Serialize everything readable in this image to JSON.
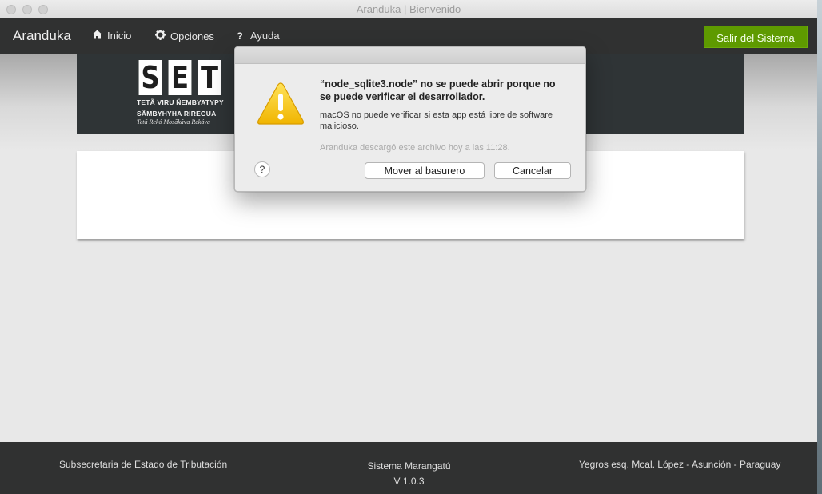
{
  "window": {
    "title": "Aranduka | Bienvenido"
  },
  "navbar": {
    "brand": "Aranduka",
    "items": [
      {
        "label": "Inicio",
        "icon": "home-icon"
      },
      {
        "label": "Opciones",
        "icon": "gear-icon"
      },
      {
        "label": "Ayuda",
        "icon": "question-icon"
      }
    ],
    "logout_label": "Salir del Sistema"
  },
  "banner": {
    "logo_letters": [
      "S",
      "E",
      "T"
    ],
    "logo_line1": "TETÃ VIRU ÑEMBYATYPY",
    "logo_line2": "SÃMBYHYHA RIREGUA",
    "logo_signature": "Tetã Rekó Mosãkãva Rekáva"
  },
  "dialog": {
    "title": "“node_sqlite3.node” no se puede abrir porque no se puede verificar el desarrollador.",
    "message": "macOS no puede verificar si esta app está libre de software malicioso.",
    "note": "Aranduka descargó este archivo hoy a las 11:28.",
    "help_label": "?",
    "trash_button": "Mover al basurero",
    "cancel_button": "Cancelar",
    "icon": "warning-icon"
  },
  "footer": {
    "left": "Subsecretaria de Estado de Tributación",
    "center_name": "Sistema Marangatú",
    "center_version": "V 1.0.3",
    "right": "Yegros esq. Mcal. López - Asunción - Paraguay"
  },
  "colors": {
    "navbar": "#303131",
    "logout_button": "#5e9a00",
    "banner": "#2f3436",
    "warning": "#f5c400"
  }
}
